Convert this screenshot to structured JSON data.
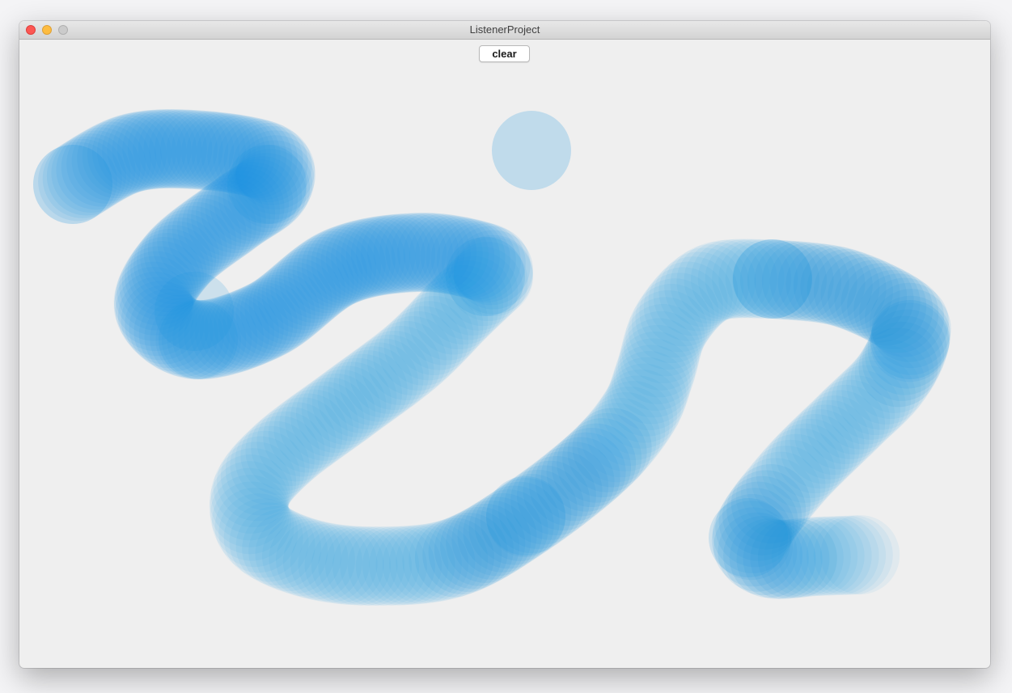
{
  "window": {
    "title": "ListenerProject"
  },
  "toolbar": {
    "clear_label": "clear"
  },
  "canvas": {
    "stroke_color": "#1a95dd",
    "background": "#efefef"
  }
}
